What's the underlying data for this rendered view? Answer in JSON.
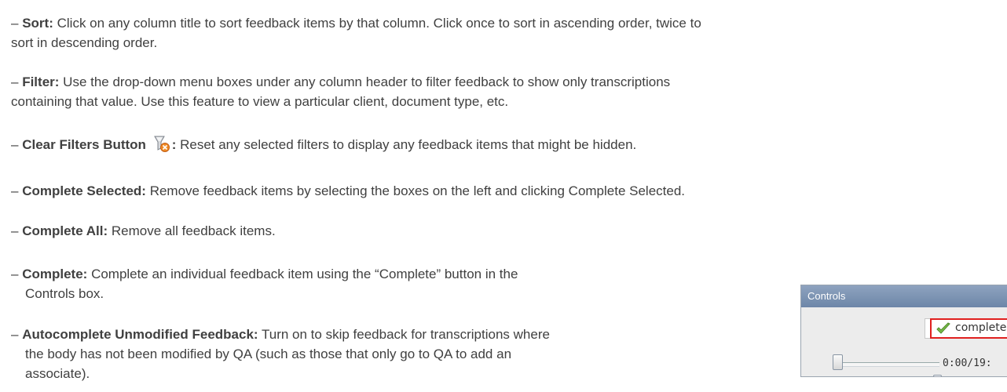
{
  "bullets": [
    {
      "dash": "–",
      "term": "Sort:",
      "desc": "Click on any column title to sort feedback items by that column.  Click once to sort in ascending order, twice to",
      "cont": "sort in descending order."
    },
    {
      "dash": "–",
      "term": "Filter:",
      "desc": "Use the drop-down menu boxes under any column header to filter feedback to show only transcriptions",
      "cont": "containing that value.  Use this feature to view a particular client, document type, etc."
    },
    {
      "dash": "–",
      "term": "Clear Filters Button",
      "term_after_icon": ":",
      "desc": "Reset any selected filters to display any feedback items that might be hidden.",
      "icon": "clear-filters-icon"
    },
    {
      "dash": "–",
      "term": "Complete Selected:",
      "desc": "Remove feedback items by selecting the boxes on the left and clicking Complete Selected."
    },
    {
      "dash": "–",
      "term": "Complete All:",
      "desc": "Remove all feedback items."
    },
    {
      "dash": "–",
      "term": "Complete:",
      "desc": "Complete an individual feedback item using the “Complete” button in the",
      "cont": "Controls box."
    },
    {
      "dash": "–",
      "term": "Autocomplete Unmodified Feedback:",
      "desc": "Turn on to skip feedback for transcriptions where",
      "cont": "the body has not been modified by QA (such as those that only go to QA to add an",
      "cont2": "associate)."
    }
  ],
  "controls": {
    "title": "Controls",
    "complete_label": "complete",
    "time": "0:00/19:",
    "icons": [
      "checkmark-icon",
      "skip-start-icon",
      "rewind-icon",
      "play-icon",
      "fast-forward-icon",
      "skip-end-icon",
      "speaker-icon"
    ],
    "highlight_color": "#e0201e"
  }
}
